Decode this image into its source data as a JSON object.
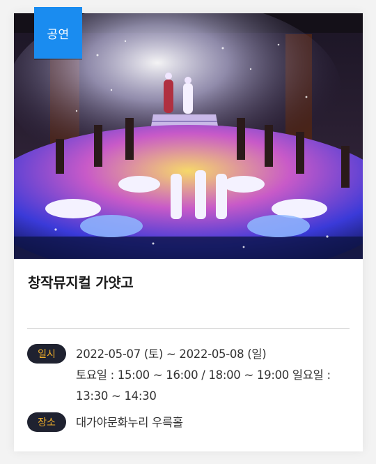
{
  "event": {
    "category": "공연",
    "title": "창작뮤지컬 가얏고",
    "photo_icon": "stage-performance-photo"
  },
  "details": {
    "date_label": "일시",
    "date_value": "2022-05-07 (토) ~ 2022-05-08 (일)",
    "time_value": "토요일 : 15:00 ~ 16:00 / 18:00 ~ 19:00 일요일 : 13:30 ~ 14:30",
    "place_label": "장소",
    "place_value": "대가야문화누리 우륵홀"
  },
  "colors": {
    "badge": "#1a8cf0",
    "label_bg": "#1f2230",
    "label_text": "#f2b02a"
  }
}
